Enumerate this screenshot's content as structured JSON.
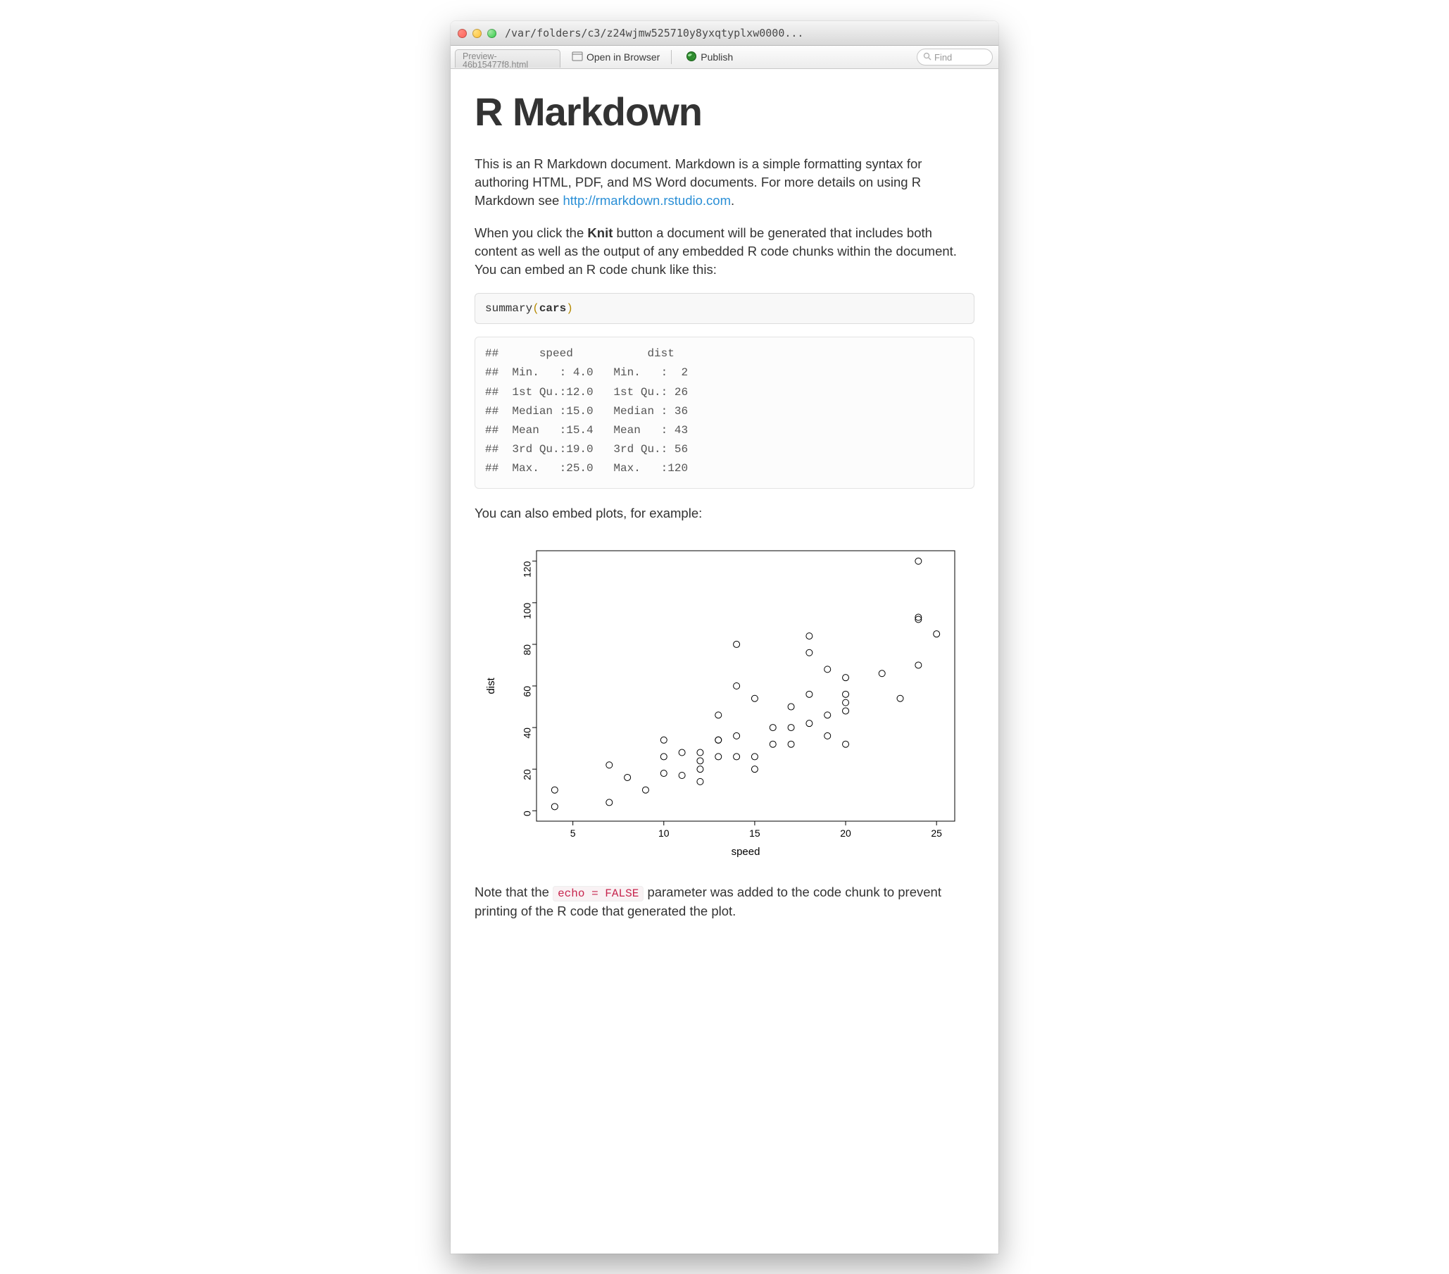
{
  "titlebar": {
    "path": "/var/folders/c3/z24wjmw525710y8yxqtyplxw0000..."
  },
  "toolbar": {
    "tab_label": "Preview-\n46b15477f8.html",
    "open_label": "Open in Browser",
    "publish_label": "Publish",
    "search_placeholder": "Find"
  },
  "doc": {
    "h1": "R Markdown",
    "p1a": "This is an R Markdown document. Markdown is a simple formatting syntax for authoring HTML, PDF, and MS Word documents. For more details on using R Markdown see ",
    "p1_link": "http://rmarkdown.rstudio.com",
    "p1b": ".",
    "p2a": "When you click the ",
    "p2_strong": "Knit",
    "p2b": " button a document will be generated that includes both content as well as the output of any embedded R code chunks within the document. You can embed an R code chunk like this:",
    "code1_fn": "summary",
    "code1_arg": "cars",
    "output_text": "##      speed           dist    \n##  Min.   : 4.0   Min.   :  2  \n##  1st Qu.:12.0   1st Qu.: 26  \n##  Median :15.0   Median : 36  \n##  Mean   :15.4   Mean   : 43  \n##  3rd Qu.:19.0   3rd Qu.: 56  \n##  Max.   :25.0   Max.   :120  ",
    "p3": "You can also embed plots, for example:",
    "p4a": "Note that the ",
    "inline_code": "echo = FALSE",
    "p4b": " parameter was added to the code chunk to prevent printing of the R code that generated the plot."
  },
  "chart_data": {
    "type": "scatter",
    "title": "",
    "xlabel": "speed",
    "ylabel": "dist",
    "xlim": [
      3,
      26
    ],
    "ylim": [
      -5,
      125
    ],
    "xticks": [
      5,
      10,
      15,
      20,
      25
    ],
    "yticks": [
      0,
      20,
      40,
      60,
      80,
      100,
      120
    ],
    "series": [
      {
        "name": "cars",
        "points": [
          [
            4,
            2
          ],
          [
            4,
            10
          ],
          [
            7,
            4
          ],
          [
            7,
            22
          ],
          [
            8,
            16
          ],
          [
            9,
            10
          ],
          [
            10,
            18
          ],
          [
            10,
            26
          ],
          [
            10,
            34
          ],
          [
            11,
            17
          ],
          [
            11,
            28
          ],
          [
            12,
            14
          ],
          [
            12,
            20
          ],
          [
            12,
            24
          ],
          [
            12,
            28
          ],
          [
            13,
            26
          ],
          [
            13,
            34
          ],
          [
            13,
            34
          ],
          [
            13,
            46
          ],
          [
            14,
            26
          ],
          [
            14,
            36
          ],
          [
            14,
            60
          ],
          [
            14,
            80
          ],
          [
            15,
            20
          ],
          [
            15,
            26
          ],
          [
            15,
            54
          ],
          [
            16,
            32
          ],
          [
            16,
            40
          ],
          [
            17,
            32
          ],
          [
            17,
            40
          ],
          [
            17,
            50
          ],
          [
            18,
            42
          ],
          [
            18,
            56
          ],
          [
            18,
            76
          ],
          [
            18,
            84
          ],
          [
            19,
            36
          ],
          [
            19,
            46
          ],
          [
            19,
            68
          ],
          [
            20,
            32
          ],
          [
            20,
            48
          ],
          [
            20,
            52
          ],
          [
            20,
            56
          ],
          [
            20,
            64
          ],
          [
            22,
            66
          ],
          [
            23,
            54
          ],
          [
            24,
            70
          ],
          [
            24,
            92
          ],
          [
            24,
            93
          ],
          [
            24,
            120
          ],
          [
            25,
            85
          ]
        ]
      }
    ]
  }
}
